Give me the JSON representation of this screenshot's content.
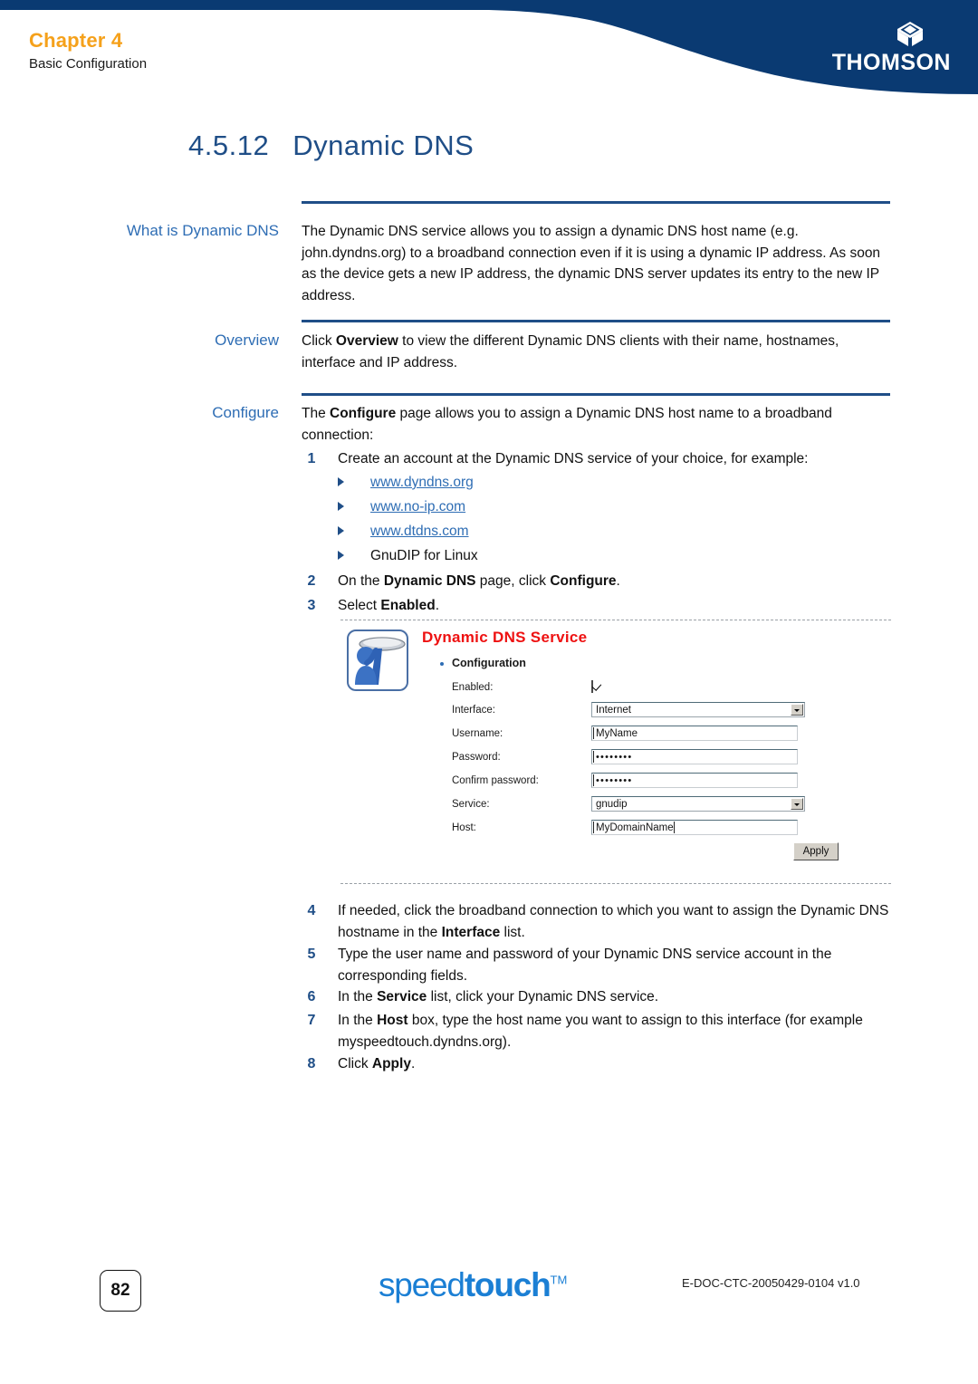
{
  "header": {
    "chapter": "Chapter 4",
    "subtitle": "Basic Configuration",
    "brand": "THOMSON",
    "brand_color": "#0A3A72",
    "accent_color": "#F5A11B"
  },
  "page_title": {
    "number": "4.5.12",
    "text": "Dynamic DNS"
  },
  "sections": [
    {
      "label": "What is Dynamic DNS",
      "paragraph": "The Dynamic DNS service allows you to assign a dynamic DNS host name (e.g. john.dyndns.org) to a broadband connection even if it is using a dynamic IP address. As soon as the device gets a new IP address, the dynamic DNS server updates its entry to the new IP address."
    },
    {
      "label": "Overview",
      "paragraph_parts": {
        "a": "Click ",
        "b1": "Overview",
        "c": " to view the different Dynamic DNS clients with their name, hostnames, interface and IP address."
      }
    },
    {
      "label": "Configure",
      "paragraph_parts": {
        "a": "The ",
        "b1": "Configure",
        "c": " page allows you to assign a Dynamic DNS host name to a broadband connection:"
      }
    }
  ],
  "steps": {
    "s1": {
      "num": "1",
      "text": "Create an account at the Dynamic DNS service of your choice, for example:"
    },
    "bullets": [
      {
        "text": "www.dyndns.org",
        "link": true
      },
      {
        "text": "www.no-ip.com",
        "link": true
      },
      {
        "text": "www.dtdns.com",
        "link": true
      },
      {
        "text": "GnuDIP for Linux",
        "link": false
      }
    ],
    "s2": {
      "num": "2",
      "a": "On the ",
      "b1": "Dynamic DNS",
      "c": " page, click ",
      "b2": "Configure",
      "d": "."
    },
    "s3": {
      "num": "3",
      "a": "Select ",
      "b1": "Enabled",
      "c": "."
    },
    "s4": {
      "num": "4",
      "a": "If needed, click the broadband connection to which you want to assign the Dynamic DNS hostname in the ",
      "b1": "Interface",
      "c": " list."
    },
    "s5": {
      "num": "5",
      "a": "Type the user name and password of your Dynamic DNS service account in the corresponding fields.",
      "b1": "",
      "c": ""
    },
    "s6": {
      "num": "6",
      "a": "In the ",
      "b1": "Service",
      "c": " list, click your Dynamic DNS service."
    },
    "s7": {
      "num": "7",
      "a": "In the ",
      "b1": "Host",
      "c": " box, type the host name you want to assign to this interface (for example myspeedtouch.dyndns.org)."
    },
    "s8": {
      "num": "8",
      "a": "Click ",
      "b1": "Apply",
      "c": "."
    }
  },
  "screenshot": {
    "title": "Dynamic DNS Service",
    "title_color": "#EE1111",
    "section": "Configuration",
    "icon_name": "dns-service-icon",
    "fields": {
      "enabled": {
        "label": "Enabled:",
        "type": "checkbox",
        "checked": true
      },
      "interface": {
        "label": "Interface:",
        "type": "select",
        "value": "Internet"
      },
      "username": {
        "label": "Username:",
        "type": "text",
        "value": "MyName"
      },
      "password": {
        "label": "Password:",
        "type": "password",
        "value": "••••••••"
      },
      "confirm_password": {
        "label": "Confirm password:",
        "type": "password",
        "value": "••••••••"
      },
      "service": {
        "label": "Service:",
        "type": "select",
        "value": "gnudip"
      },
      "host": {
        "label": "Host:",
        "type": "text",
        "value": "MyDomainName"
      }
    },
    "apply_label": "Apply"
  },
  "footer": {
    "page_number": "82",
    "brand_light": "speed",
    "brand_bold": "touch",
    "brand_tm": "TM",
    "doc_code": "E-DOC-CTC-20050429-0104 v1.0"
  }
}
